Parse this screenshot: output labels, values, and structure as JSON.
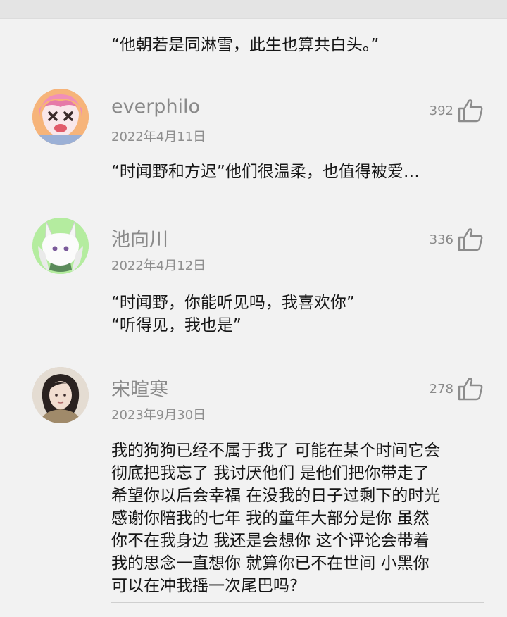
{
  "top_comment": {
    "text": "“他朝若是同淋雪，此生也算共白头。”"
  },
  "comments": [
    {
      "user": "everphilo",
      "date": "2022年4月11日",
      "likes": "392",
      "lines": [
        "“时闻野和方迟”他们很温柔，也值得被爱…"
      ],
      "avatar_icon": "cartoon-girl-avatar"
    },
    {
      "user": "池向川",
      "date": "2022年4月12日",
      "likes": "336",
      "lines": [
        "“时闻野，你能听见吗，我喜欢你”",
        "“听得见，我也是”"
      ],
      "avatar_icon": "white-fox-avatar"
    },
    {
      "user": "宋暄寒",
      "date": "2023年9月30日",
      "likes": "278",
      "lines": [
        "我的狗狗已经不属于我了 可能在某个时间它会",
        "彻底把我忘了 我讨厌他们 是他们把你带走了",
        "希望你以后会幸福 在没我的日子过剩下的时光",
        "感谢你陪我的七年 我的童年大部分是你 虽然",
        "你不在我身边 我还是会想你 这个评论会带着",
        "我的思念一直想你 就算你已不在世间 小黑你",
        "可以在冲我摇一次尾巴吗?"
      ],
      "avatar_icon": "photo-avatar"
    }
  ],
  "colors": {
    "background": "#f2f2f2",
    "username": "#8a8a8a",
    "text": "#161616",
    "divider": "#cfcfcf"
  }
}
